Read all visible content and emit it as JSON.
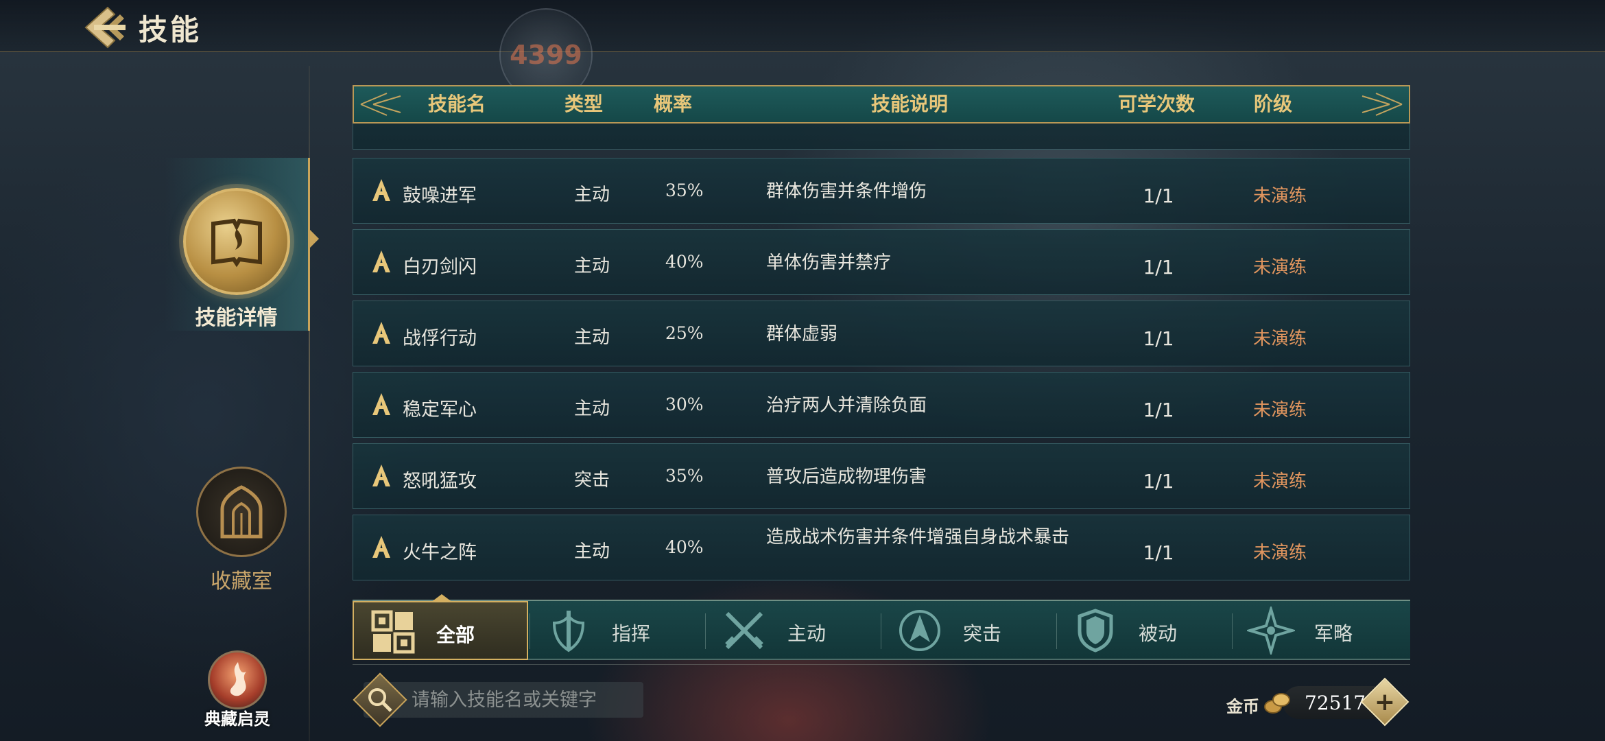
{
  "header": {
    "title": "技能",
    "watermark": "4399"
  },
  "sidebar": {
    "items": [
      {
        "label": "技能详情",
        "active": true
      },
      {
        "label": "收藏室",
        "active": false
      },
      {
        "label": "典藏启灵",
        "active": false
      }
    ]
  },
  "table": {
    "columns": [
      "技能名",
      "类型",
      "概率",
      "技能说明",
      "可学次数",
      "阶级"
    ],
    "rows": [
      {
        "rank": "A",
        "name": "鼓噪进军",
        "type": "主动",
        "rate": "35%",
        "description": "群体伤害并条件增伤",
        "count": "1/1",
        "status": "未演练"
      },
      {
        "rank": "A",
        "name": "白刃剑闪",
        "type": "主动",
        "rate": "40%",
        "description": "单体伤害并禁疗",
        "count": "1/1",
        "status": "未演练"
      },
      {
        "rank": "A",
        "name": "战俘行动",
        "type": "主动",
        "rate": "25%",
        "description": "群体虚弱",
        "count": "1/1",
        "status": "未演练"
      },
      {
        "rank": "A",
        "name": "稳定军心",
        "type": "主动",
        "rate": "30%",
        "description": "治疗两人并清除负面",
        "count": "1/1",
        "status": "未演练"
      },
      {
        "rank": "A",
        "name": "怒吼猛攻",
        "type": "突击",
        "rate": "35%",
        "description": "普攻后造成物理伤害",
        "count": "1/1",
        "status": "未演练"
      },
      {
        "rank": "A",
        "name": "火牛之阵",
        "type": "主动",
        "rate": "40%",
        "description": "造成战术伤害并条件增强自身战术暴击",
        "count": "1/1",
        "status": "未演练"
      }
    ]
  },
  "filter_tabs": [
    {
      "label": "全部",
      "icon": "grid-icon",
      "active": true
    },
    {
      "label": "指挥",
      "icon": "sword-shield-icon",
      "active": false
    },
    {
      "label": "主动",
      "icon": "crossed-swords-icon",
      "active": false
    },
    {
      "label": "突击",
      "icon": "arrow-up-icon",
      "active": false
    },
    {
      "label": "被动",
      "icon": "shield-icon",
      "active": false
    },
    {
      "label": "军略",
      "icon": "star-compass-icon",
      "active": false
    }
  ],
  "search": {
    "placeholder": "请输入技能名或关键字",
    "value": ""
  },
  "currency": {
    "label": "金币",
    "amount": "72517",
    "add_label": "+"
  },
  "colors": {
    "accent_gold": "#c9a45a",
    "status_orange": "#e0955e",
    "header_teal": "#1e5a5a"
  }
}
